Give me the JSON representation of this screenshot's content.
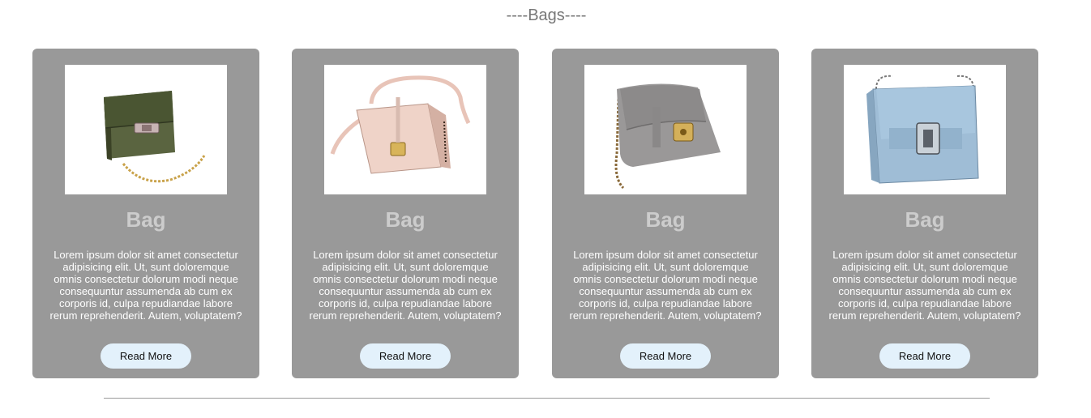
{
  "section": {
    "title": "----Bags----"
  },
  "cards": [
    {
      "image_icon": "green-chain-bag-image",
      "title": "Bag",
      "description": "Lorem ipsum dolor sit amet consectetur adipisicing elit. Ut, sunt doloremque omnis consectetur dolorum modi neque consequuntur assumenda ab cum ex corporis id, culpa repudiandae labore rerum reprehenderit. Autem, voluptatem?",
      "button_label": "Read More",
      "bag_color": "#4a5532"
    },
    {
      "image_icon": "pink-crossbody-bag-image",
      "title": "Bag",
      "description": "Lorem ipsum dolor sit amet consectetur adipisicing elit. Ut, sunt doloremque omnis consectetur dolorum modi neque consequuntur assumenda ab cum ex corporis id, culpa repudiandae labore rerum reprehenderit. Autem, voluptatem?",
      "button_label": "Read More",
      "bag_color": "#efd3c8"
    },
    {
      "image_icon": "gray-chain-bag-image",
      "title": "Bag",
      "description": "Lorem ipsum dolor sit amet consectetur adipisicing elit. Ut, sunt doloremque omnis consectetur dolorum modi neque consequuntur assumenda ab cum ex corporis id, culpa repudiandae labore rerum reprehenderit. Autem, voluptatem?",
      "button_label": "Read More",
      "bag_color": "#9a9898"
    },
    {
      "image_icon": "blue-studded-bag-image",
      "title": "Bag",
      "description": "Lorem ipsum dolor sit amet consectetur adipisicing elit. Ut, sunt doloremque omnis consectetur dolorum modi neque consequuntur assumenda ab cum ex corporis id, culpa repudiandae labore rerum reprehenderit. Autem, voluptatem?",
      "button_label": "Read More",
      "bag_color": "#9fbdd6"
    }
  ],
  "colors": {
    "card_background": "#999999",
    "card_title": "#cccccc",
    "button_background": "#e3f1fb",
    "section_title": "#777777"
  }
}
